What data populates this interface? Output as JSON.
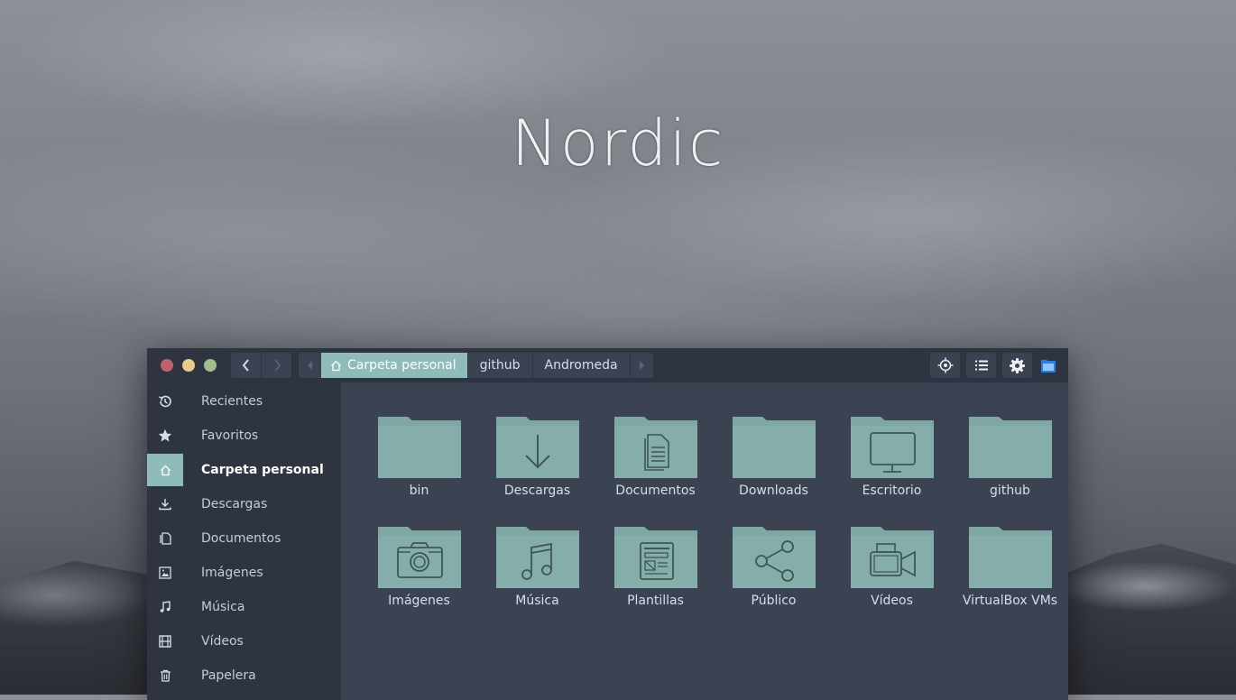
{
  "wallpaper": {
    "title": "Nordic"
  },
  "colors": {
    "accent": "#8fbcbb",
    "titlebar": "#2e3440",
    "window_bg": "#3b4252",
    "folder": "#7fa8a5"
  },
  "window": {
    "controls": [
      "close",
      "minimize",
      "maximize"
    ],
    "path": [
      "Carpeta personal",
      "github",
      "Andromeda"
    ],
    "toolbar_icons": [
      "locate-icon",
      "list-view-icon",
      "settings-icon",
      "app-icon"
    ]
  },
  "sidebar": {
    "items": [
      {
        "label": "Recientes",
        "icon": "history-icon"
      },
      {
        "label": "Favoritos",
        "icon": "star-icon"
      },
      {
        "label": "Carpeta personal",
        "icon": "home-icon",
        "active": true
      },
      {
        "label": "Descargas",
        "icon": "download-icon"
      },
      {
        "label": "Documentos",
        "icon": "document-icon"
      },
      {
        "label": "Imágenes",
        "icon": "image-icon"
      },
      {
        "label": "Música",
        "icon": "music-icon"
      },
      {
        "label": "Vídeos",
        "icon": "film-icon"
      },
      {
        "label": "Papelera",
        "icon": "trash-icon"
      }
    ]
  },
  "files": [
    {
      "name": "bin",
      "emblem": "none"
    },
    {
      "name": "Descargas",
      "emblem": "download"
    },
    {
      "name": "Documentos",
      "emblem": "document"
    },
    {
      "name": "Downloads",
      "emblem": "none"
    },
    {
      "name": "Escritorio",
      "emblem": "desktop"
    },
    {
      "name": "github",
      "emblem": "none"
    },
    {
      "name": "Imágenes",
      "emblem": "camera"
    },
    {
      "name": "Música",
      "emblem": "music"
    },
    {
      "name": "Plantillas",
      "emblem": "template"
    },
    {
      "name": "Público",
      "emblem": "share"
    },
    {
      "name": "Vídeos",
      "emblem": "video"
    },
    {
      "name": "VirtualBox VMs",
      "emblem": "none"
    }
  ]
}
